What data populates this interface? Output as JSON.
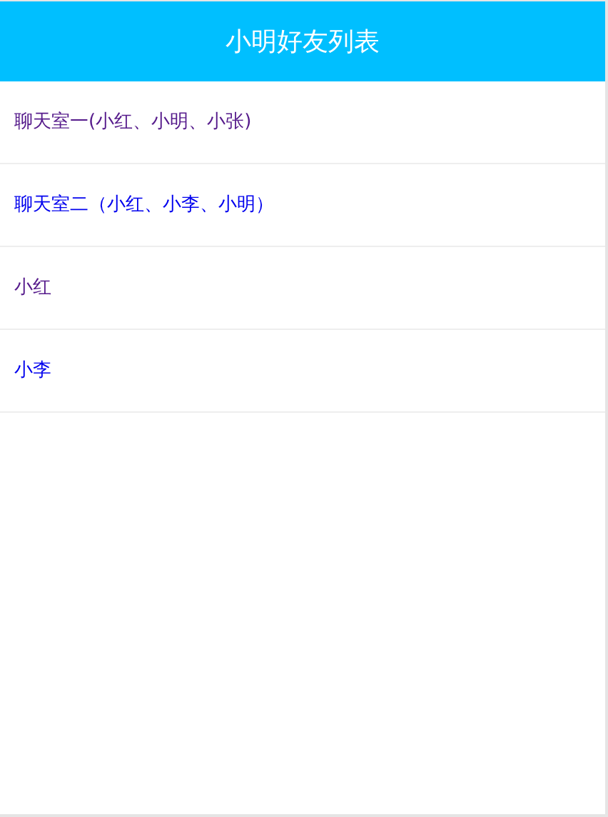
{
  "header": {
    "title": "小明好友列表"
  },
  "items": [
    {
      "label": "聊天室一(小红、小明、小张)",
      "visited": true
    },
    {
      "label": "聊天室二（小红、小李、小明）",
      "visited": false
    },
    {
      "label": "小红",
      "visited": true
    },
    {
      "label": "小李",
      "visited": false
    }
  ]
}
